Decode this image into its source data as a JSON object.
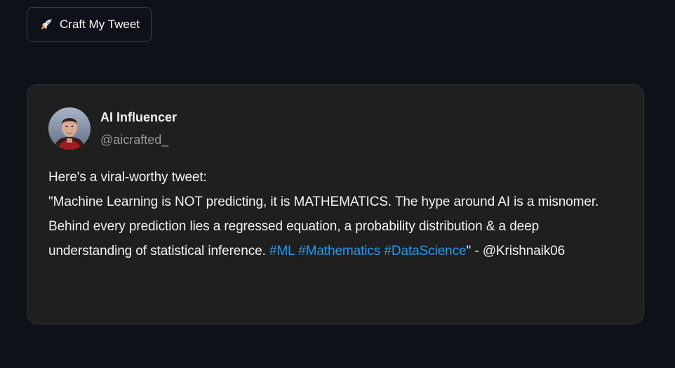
{
  "button": {
    "icon": "rocket-icon",
    "label": "Craft My Tweet"
  },
  "tweet": {
    "display_name": "AI Influencer",
    "handle": "@aicrafted_",
    "intro": "Here's a viral-worthy tweet:",
    "quote_text": "\"Machine Learning is NOT predicting, it is MATHEMATICS. The hype around AI is a misnomer. Behind every prediction lies a regressed equation, a probability distribution & a deep understanding of statistical inference.",
    "hashtags": [
      "#ML",
      "#Mathematics",
      "#DataScience"
    ],
    "attribution": "\" - @Krishnaik06"
  },
  "colors": {
    "background": "#0e1117",
    "card": "#1f1f1f",
    "hashtag": "#1d9bf0"
  }
}
